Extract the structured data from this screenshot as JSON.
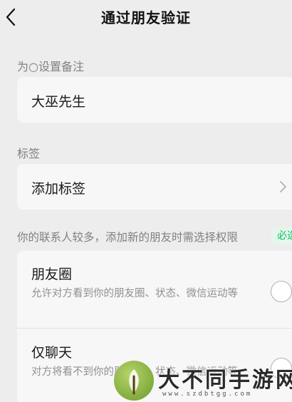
{
  "nav": {
    "title": "通过朋友验证"
  },
  "remark": {
    "label": "为○设置备注",
    "value": "大巫先生"
  },
  "tags": {
    "label": "标签",
    "value": "添加标签"
  },
  "permissions": {
    "hint": "你的联系人较多，添加新的朋友时需选择权限",
    "badge": "必选",
    "options": [
      {
        "title": "朋友圈",
        "desc": "允许对方看到你的朋友圈、状态、微信运动等"
      },
      {
        "title": "仅聊天",
        "desc": "对方将看不到你的朋友圈、状态、微信运动等"
      }
    ]
  },
  "watermark": {
    "text": "大不同手游网",
    "url": "www.szdbtgg.com"
  },
  "colors": {
    "background": "#ededed",
    "card": "#f7f7f7",
    "accent": "#07c160"
  }
}
